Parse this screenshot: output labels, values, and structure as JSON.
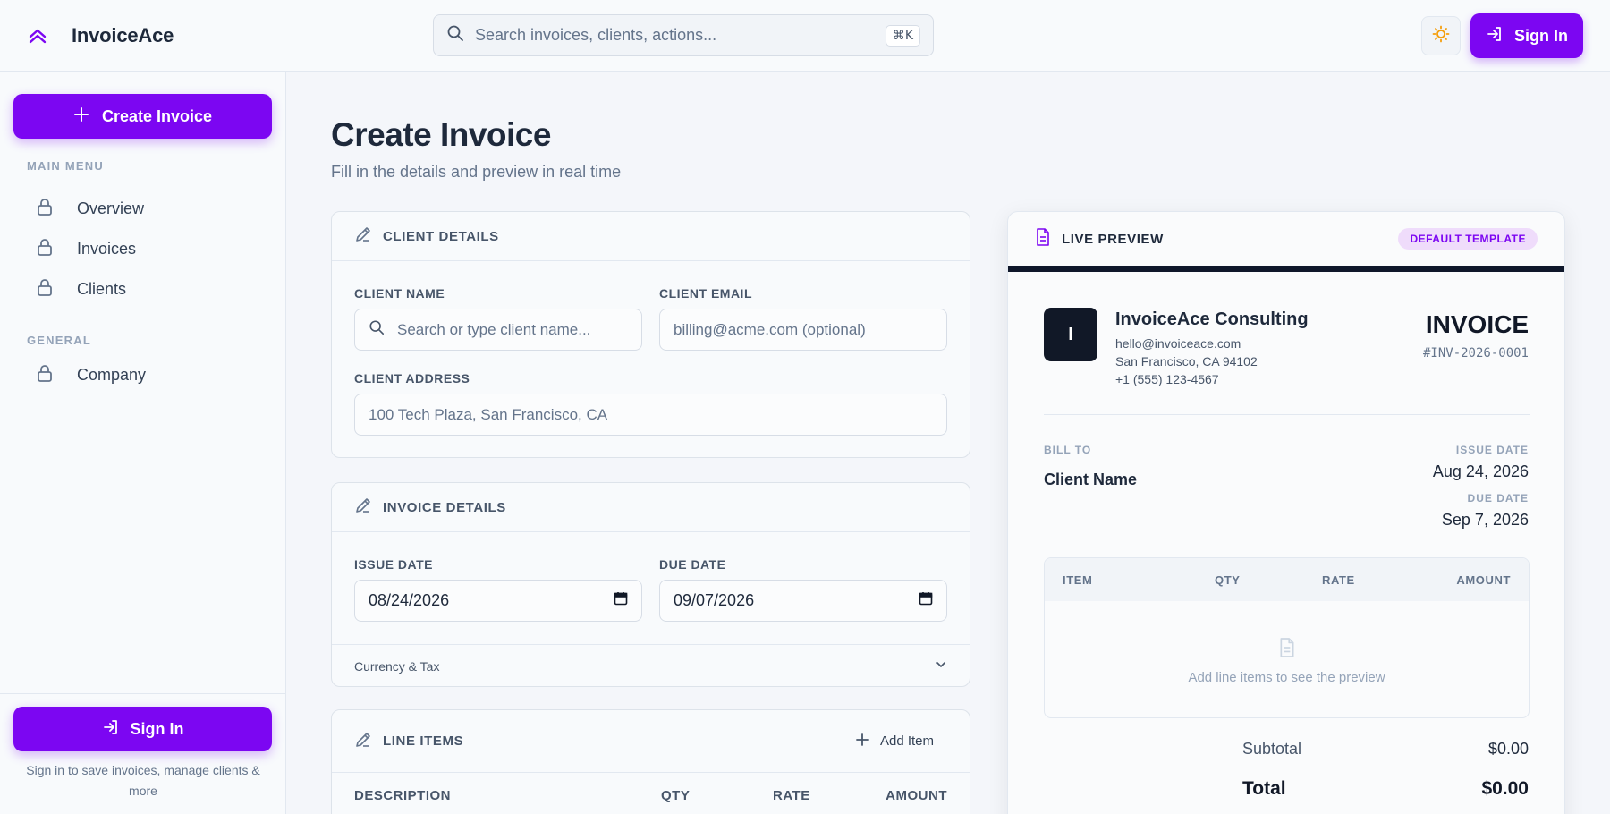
{
  "app": {
    "name": "InvoiceAce"
  },
  "header": {
    "search_placeholder": "Search invoices, clients, actions...",
    "shortcut": "⌘K",
    "signin_label": "Sign In"
  },
  "sidebar": {
    "create_label": "Create Invoice",
    "main_menu_label": "MAIN MENU",
    "main_items": [
      {
        "label": "Overview",
        "icon": "lock-icon"
      },
      {
        "label": "Invoices",
        "icon": "lock-icon"
      },
      {
        "label": "Clients",
        "icon": "lock-icon"
      }
    ],
    "general_label": "GENERAL",
    "general_items": [
      {
        "label": "Company",
        "icon": "lock-icon"
      }
    ],
    "signin_label": "Sign In",
    "signin_note": "Sign in to save invoices, manage clients & more"
  },
  "page": {
    "title": "Create Invoice",
    "subtitle": "Fill in the details and preview in real time"
  },
  "client_details": {
    "title": "CLIENT DETAILS",
    "name_label": "CLIENT NAME",
    "name_placeholder": "Search or type client name...",
    "email_label": "CLIENT EMAIL",
    "email_placeholder": "billing@acme.com (optional)",
    "address_label": "CLIENT ADDRESS",
    "address_placeholder": "100 Tech Plaza, San Francisco, CA"
  },
  "invoice_details": {
    "title": "INVOICE DETAILS",
    "issue_label": "ISSUE DATE",
    "issue_value": "08/24/2026",
    "due_label": "DUE DATE",
    "due_value": "09/07/2026",
    "currency_tax_label": "Currency & Tax"
  },
  "line_items": {
    "title": "LINE ITEMS",
    "add_label": "Add Item",
    "columns": [
      "DESCRIPTION",
      "QTY",
      "RATE",
      "AMOUNT"
    ]
  },
  "preview": {
    "title": "LIVE PREVIEW",
    "badge": "DEFAULT TEMPLATE",
    "company_initial": "I",
    "company_name": "InvoiceAce Consulting",
    "company_email": "hello@invoiceace.com",
    "company_city": "San Francisco, CA 94102",
    "company_phone": "+1 (555) 123-4567",
    "doc_type": "INVOICE",
    "number": "#INV-2026-0001",
    "bill_to_label": "BILL TO",
    "bill_to_value": "Client Name",
    "issue_label": "ISSUE DATE",
    "issue_value": "Aug 24, 2026",
    "due_label": "DUE DATE",
    "due_value": "Sep 7, 2026",
    "columns": [
      "ITEM",
      "QTY",
      "RATE",
      "AMOUNT"
    ],
    "empty_text": "Add line items to see the preview",
    "subtotal_label": "Subtotal",
    "subtotal_value": "$0.00",
    "total_label": "Total",
    "total_value": "$0.00"
  },
  "colors": {
    "accent": "#7c06f2",
    "text_dark": "#1e293b",
    "muted": "#64748b",
    "border": "#e2e8f0"
  }
}
